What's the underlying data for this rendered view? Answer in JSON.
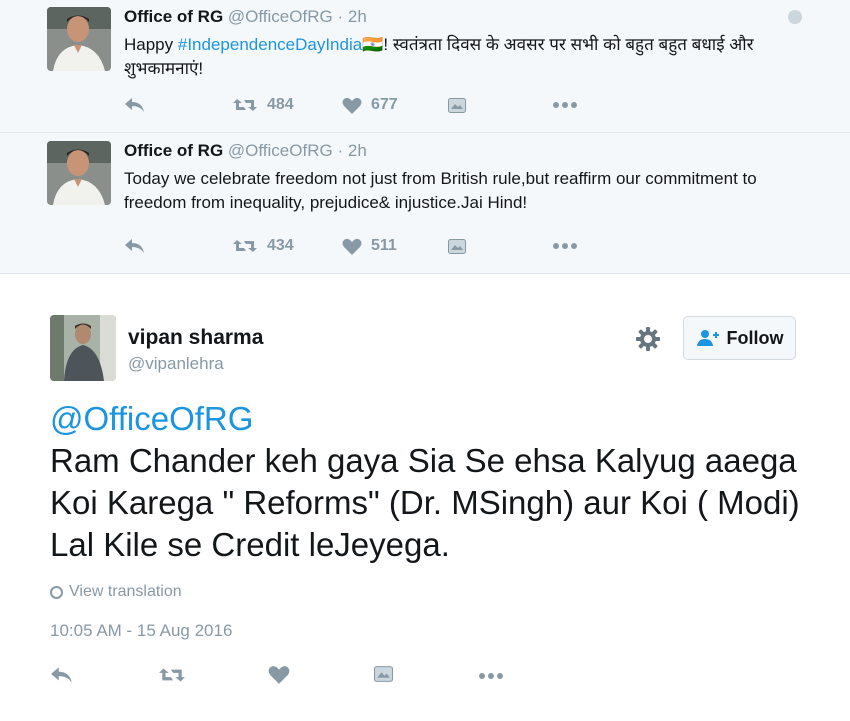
{
  "thread": [
    {
      "name": "Office of RG",
      "handle": "@OfficeOfRG",
      "dot": "·",
      "time": "2h",
      "text_prefix": "Happy ",
      "hashtag": "#IndependenceDayIndia",
      "text_suffix": "🇮🇳! स्वतंत्रता दिवस के अवसर पर सभी को बहुत बहुत बधाई और शुभकामनाएं!",
      "retweets": "484",
      "likes": "677"
    },
    {
      "name": "Office of RG",
      "handle": "@OfficeOfRG",
      "dot": "·",
      "time": "2h",
      "text": "Today we celebrate freedom not just from British rule,but reaffirm our commitment to freedom from inequality, prejudice& injustice.Jai Hind!",
      "retweets": "434",
      "likes": "511"
    }
  ],
  "main_tweet": {
    "name": "vipan sharma",
    "handle": "@vipanlehra",
    "follow_label": "Follow",
    "mention": "@OfficeOfRG",
    "text": "Ram Chander keh gaya Sia Se ehsa Kalyug aaega Koi Karega \" Reforms\" (Dr. MSingh) aur Koi (  Modi)  Lal Kile se Credit leJeyega.",
    "view_translation": "View translation",
    "timestamp": "10:05 AM - 15 Aug 2016"
  },
  "icons": {
    "reply": "reply-icon",
    "retweet": "retweet-icon",
    "like": "heart-icon",
    "dm": "message-icon",
    "more": "more-icon",
    "gear": "gear-icon",
    "follow": "follow-person-icon",
    "globe": "globe-icon"
  },
  "colors": {
    "link": "#1b95e0",
    "muted": "#8899a6",
    "thread_bg": "#f5f8fa",
    "text": "#14171a"
  }
}
